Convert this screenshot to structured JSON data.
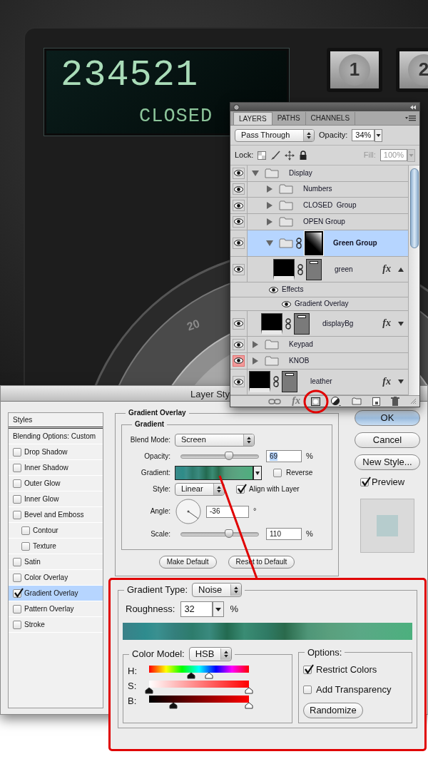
{
  "artwork": {
    "display_digits": "234521",
    "display_status": "CLOSED",
    "keys": [
      "1",
      "2"
    ],
    "dial_label": "20"
  },
  "layers_panel": {
    "tabs": [
      {
        "label": "LAYERS",
        "selected": true
      },
      {
        "label": "PATHS",
        "selected": false
      },
      {
        "label": "CHANNELS",
        "selected": false
      }
    ],
    "blend_mode": "Pass Through",
    "opacity_label": "Opacity:",
    "opacity": "34%",
    "lock_label": "Lock:",
    "fill_label": "Fill:",
    "fill": "100%",
    "fill_disabled": true,
    "layers": [
      {
        "kind": "group",
        "name": "Display",
        "visible": true,
        "eye_highlighted": false,
        "expanded": true,
        "selected": false,
        "children": [
          {
            "kind": "group",
            "name": "Numbers",
            "visible": true,
            "eye_highlighted": false,
            "expanded": false,
            "selected": false
          },
          {
            "kind": "group",
            "name": "CLOSED  Group",
            "visible": true,
            "eye_highlighted": false,
            "expanded": false,
            "selected": false
          },
          {
            "kind": "group",
            "name": "OPEN Group",
            "visible": true,
            "eye_highlighted": false,
            "expanded": false,
            "selected": false
          },
          {
            "kind": "group",
            "name": "Green Group",
            "visible": true,
            "eye_highlighted": false,
            "expanded": true,
            "selected": true,
            "mask": true,
            "children": [
              {
                "kind": "layer",
                "name": "green",
                "visible": true,
                "eye_highlighted": false,
                "selected": false,
                "fx": "fx",
                "effects": {
                  "label": "Effects",
                  "visible": true,
                  "items": [
                    {
                      "label": "Gradient Overlay",
                      "visible": true
                    }
                  ]
                }
              }
            ]
          },
          {
            "kind": "layer",
            "name": "displayBg",
            "visible": true,
            "eye_highlighted": false,
            "selected": false,
            "fx": "fx"
          }
        ]
      },
      {
        "kind": "group",
        "name": "Keypad",
        "visible": true,
        "eye_highlighted": false,
        "expanded": false,
        "selected": false
      },
      {
        "kind": "group",
        "name": "KNOB",
        "visible": true,
        "eye_highlighted": true,
        "expanded": false,
        "selected": false
      },
      {
        "kind": "layer",
        "name": "leather",
        "visible": true,
        "eye_highlighted": false,
        "selected": false,
        "fx": "fx"
      }
    ],
    "toolbar_fx": "fx"
  },
  "layer_style": {
    "title": "Layer Sty",
    "styles_header": "Styles",
    "blending_options": "Blending Options: Custom",
    "effects": [
      {
        "label": "Drop Shadow",
        "checked": false,
        "selected": false
      },
      {
        "label": "Inner Shadow",
        "checked": false,
        "selected": false
      },
      {
        "label": "Outer Glow",
        "checked": false,
        "selected": false
      },
      {
        "label": "Inner Glow",
        "checked": false,
        "selected": false
      },
      {
        "label": "Bevel and Emboss",
        "checked": false,
        "selected": false,
        "children": [
          {
            "label": "Contour",
            "checked": false,
            "selected": false
          },
          {
            "label": "Texture",
            "checked": false,
            "selected": false
          }
        ]
      },
      {
        "label": "Satin",
        "checked": false,
        "selected": false
      },
      {
        "label": "Color Overlay",
        "checked": false,
        "selected": false
      },
      {
        "label": "Gradient Overlay",
        "checked": true,
        "selected": true
      },
      {
        "label": "Pattern Overlay",
        "checked": false,
        "selected": false
      },
      {
        "label": "Stroke",
        "checked": false,
        "selected": false
      }
    ],
    "gradient_overlay": {
      "title": "Gradient Overlay",
      "group_title": "Gradient",
      "blend_mode_label": "Blend Mode:",
      "blend_mode": "Screen",
      "opacity_label": "Opacity:",
      "opacity": {
        "level": 0.62,
        "value": "69",
        "unit": "%",
        "text_selected": true
      },
      "gradient_label": "Gradient:",
      "reverse": {
        "label": "Reverse",
        "checked": false
      },
      "style_label": "Style:",
      "style": "Linear",
      "align": {
        "label": "Align with Layer",
        "checked": true
      },
      "angle_label": "Angle:",
      "angle": "-36",
      "angle_unit": "°",
      "scale_label": "Scale:",
      "scale": {
        "level": 0.62,
        "value": "110",
        "unit": "%",
        "text_selected": false
      },
      "buttons": [
        "Make Default",
        "Reset to Default"
      ]
    },
    "actions": [
      {
        "label": "OK",
        "default": true
      },
      {
        "label": "Cancel",
        "default": false
      },
      {
        "label": "New Style...",
        "default": false
      }
    ],
    "preview": {
      "label": "Preview",
      "checked": true
    }
  },
  "callout": {
    "gradient_type_label": "Gradient Type:",
    "gradient_type": "Noise",
    "roughness_label": "Roughness:",
    "roughness": "32",
    "roughness_unit": "%",
    "color_model_label": "Color Model:",
    "color_model": "HSB",
    "channels": [
      {
        "label": "H:",
        "kind": "hue",
        "thumbs": [
          {
            "kind": "min",
            "level": 0.42
          },
          {
            "kind": "max",
            "level": 0.6
          }
        ]
      },
      {
        "label": "S:",
        "kind": "saturation",
        "thumbs": [
          {
            "kind": "min",
            "level": 0.0
          },
          {
            "kind": "max",
            "level": 1.0
          }
        ]
      },
      {
        "label": "B:",
        "kind": "brightness",
        "thumbs": [
          {
            "kind": "min",
            "level": 0.24
          },
          {
            "kind": "max",
            "level": 1.0
          }
        ]
      }
    ],
    "options_label": "Options:",
    "options": [
      {
        "label": "Restrict Colors",
        "checked": true
      },
      {
        "label": "Add Transparency",
        "checked": false
      }
    ],
    "randomize": "Randomize"
  }
}
